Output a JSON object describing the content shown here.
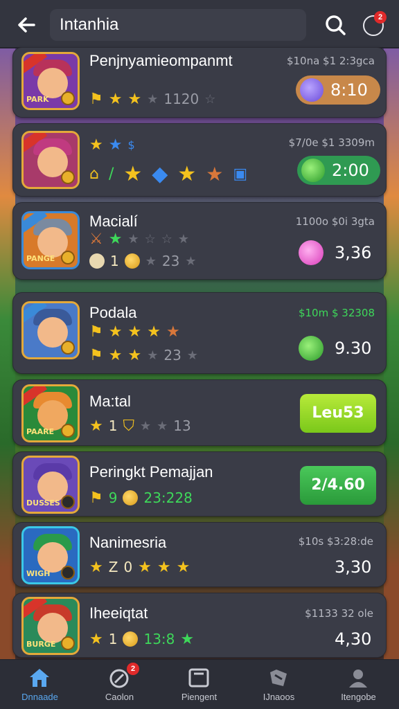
{
  "header": {
    "title": "Intanhia",
    "notification_count": "2"
  },
  "games": [
    {
      "name": "Penjnyamieompanmt",
      "stat": "$10na $1 2:3gca",
      "rating_value": "1120",
      "price": "8:10",
      "icon_label": "PARK",
      "hat_color": "#b8325a",
      "tile_bg": "#7a3aa8"
    },
    {
      "name": "",
      "stat": "$7/0e $1 3309m",
      "price": "2:00",
      "icon_label": "",
      "hat_color": "#c03a80",
      "tile_bg": "#a83a6a"
    },
    {
      "name": "Macialí",
      "stat": "1100o $0i 3gta",
      "rating_value": "1",
      "rating_value_2": "23",
      "price": "3,36",
      "icon_label": "PANGE",
      "hat_color": "#7a8aa0",
      "tile_bg": "#d87a2a"
    },
    {
      "name": "Podala",
      "stat": "$10m $ 32308",
      "rating_value": "23",
      "price": "9.30",
      "icon_label": "",
      "hat_color": "#3a5a9a",
      "tile_bg": "#4a7ac8"
    },
    {
      "name": "Ma:tal",
      "rating_value": "1",
      "rating_value_2": "13",
      "button_label": "Leu53",
      "icon_label": "PAARE",
      "hat_color": "#e88a30",
      "tile_bg": "#2a8a3a"
    },
    {
      "name": "Peringkt Pemajjan",
      "rating_value": "9",
      "rating_value_2": "23:228",
      "button_label": "2/4.60",
      "icon_label": "DUSSES",
      "hat_color": "#5a3aa8",
      "tile_bg": "#6a4ab8"
    },
    {
      "name": "Nanimesria",
      "stat": "$10s $3:28:de",
      "rating_value": "Z",
      "rating_value_2": "0",
      "price": "3,30",
      "icon_label": "WIGH",
      "hat_color": "#2a9a4a",
      "tile_bg": "#2a6ac0"
    },
    {
      "name": "Iheeiqtat",
      "stat": "$1133 32 ole",
      "rating_value": "1",
      "rating_value_2": "13:8",
      "price": "4,30",
      "icon_label": "BURGE",
      "hat_color": "#c83a2a",
      "tile_bg": "#2a8a5a"
    }
  ],
  "tabs": [
    {
      "label": "Dnnaade",
      "icon": "home-icon",
      "active": true
    },
    {
      "label": "Caolon",
      "icon": "rocket-icon",
      "badge": "2"
    },
    {
      "label": "Piengent",
      "icon": "inbox-icon"
    },
    {
      "label": "IJnaoos",
      "icon": "puzzle-icon"
    },
    {
      "label": "Itengobe",
      "icon": "profile-icon"
    }
  ],
  "colors": {
    "card_bg": "#3a3c47",
    "header_bg": "#33353f",
    "accent_blue": "#5aa8f0",
    "green": "#3ed85a",
    "star_gold": "#f4c21e",
    "orange_pill": "#c8884a"
  }
}
